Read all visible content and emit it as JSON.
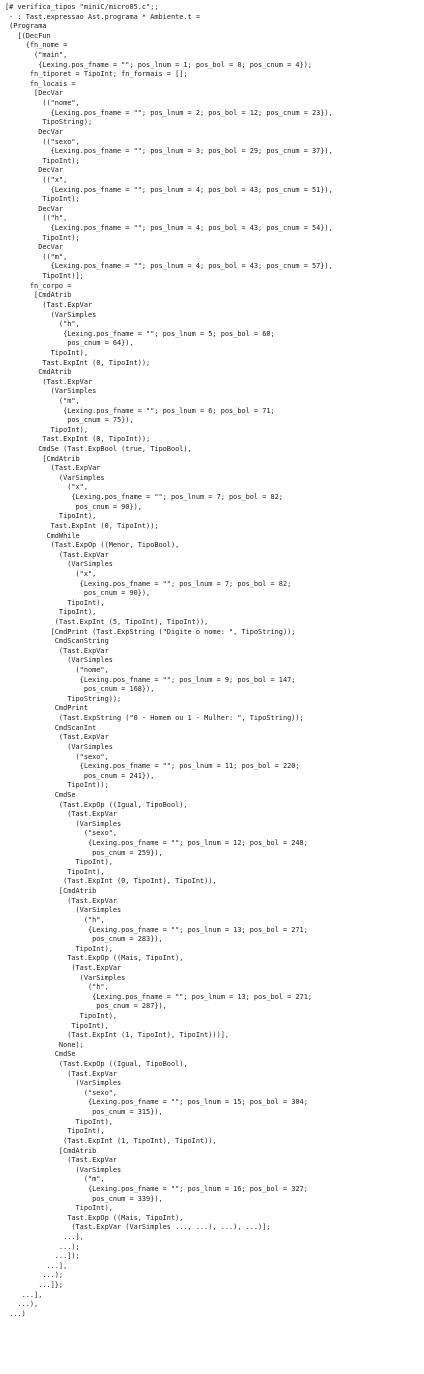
{
  "terminal": {
    "lines": [
      "[# verifica_tipos \"miniC/micro05.c\";;",
      " - : Tast.expressao Ast.programa * Ambiente.t =",
      " (Programa",
      "   [(DecFun",
      "     {fn_nome =",
      "       (\"main\",",
      "        {Lexing.pos_fname = \"\"; pos_lnum = 1; pos_bol = 0; pos_cnum = 4});",
      "      fn_tiporet = TipoInt; fn_formais = [];",
      "      fn_locais =",
      "       [DecVar",
      "         ((\"nome\",",
      "           {Lexing.pos_fname = \"\"; pos_lnum = 2; pos_bol = 12; pos_cnum = 23}),",
      "         TipoString);",
      "        DecVar",
      "         ((\"sexo\",",
      "           {Lexing.pos_fname = \"\"; pos_lnum = 3; pos_bol = 29; pos_cnum = 37}),",
      "         TipoInt);",
      "        DecVar",
      "         ((\"x\",",
      "           {Lexing.pos_fname = \"\"; pos_lnum = 4; pos_bol = 43; pos_cnum = 51}),",
      "         TipoInt);",
      "        DecVar",
      "         ((\"h\",",
      "           {Lexing.pos_fname = \"\"; pos_lnum = 4; pos_bol = 43; pos_cnum = 54}),",
      "         TipoInt);",
      "        DecVar",
      "         ((\"m\",",
      "           {Lexing.pos_fname = \"\"; pos_lnum = 4; pos_bol = 43; pos_cnum = 57}),",
      "         TipoInt)];",
      "      fn_corpo =",
      "       [CmdAtrib",
      "         (Tast.ExpVar",
      "           (VarSimples",
      "             (\"h\",",
      "              {Lexing.pos_fname = \"\"; pos_lnum = 5; pos_bol = 60;",
      "               pos_cnum = 64}),",
      "           TipoInt),",
      "         Tast.ExpInt (0, TipoInt));",
      "        CmdAtrib",
      "         (Tast.ExpVar",
      "           (VarSimples",
      "             (\"m\",",
      "              {Lexing.pos_fname = \"\"; pos_lnum = 6; pos_bol = 71;",
      "               pos_cnum = 75}),",
      "           TipoInt),",
      "         Tast.ExpInt (0, TipoInt));",
      "        CmdSe (Tast.ExpBool (true, TipoBool),",
      "         [CmdAtrib",
      "           (Tast.ExpVar",
      "             (VarSimples",
      "               (\"x\",",
      "                {Lexing.pos_fname = \"\"; pos_lnum = 7; pos_bol = 82;",
      "                 pos_cnum = 90}),",
      "             TipoInt),",
      "           Tast.ExpInt (0, TipoInt));",
      "          CmdWhile",
      "           (Tast.ExpOp ((Menor, TipoBool),",
      "             (Tast.ExpVar",
      "               (VarSimples",
      "                 (\"x\",",
      "                  {Lexing.pos_fname = \"\"; pos_lnum = 7; pos_bol = 82;",
      "                   pos_cnum = 90}),",
      "               TipoInt),",
      "             TipoInt),",
      "            (Tast.ExpInt (5, TipoInt), TipoInt)),",
      "           [CmdPrint (Tast.ExpString (\"Digite o nome: \", TipoString));",
      "            CmdScanString",
      "             (Tast.ExpVar",
      "               (VarSimples",
      "                 (\"nome\",",
      "                  {Lexing.pos_fname = \"\"; pos_lnum = 9; pos_bol = 147;",
      "                   pos_cnum = 168}),",
      "               TipoString));",
      "            CmdPrint",
      "             (Tast.ExpString (\"0 - Homem ou 1 - Mulher: \", TipoString));",
      "            CmdScanInt",
      "             (Tast.ExpVar",
      "               (VarSimples",
      "                 (\"sexo\",",
      "                  {Lexing.pos_fname = \"\"; pos_lnum = 11; pos_bol = 220;",
      "                   pos_cnum = 241}),",
      "               TipoInt));",
      "            CmdSe",
      "             (Tast.ExpOp ((Igual, TipoBool),",
      "               (Tast.ExpVar",
      "                 (VarSimples",
      "                   (\"sexo\",",
      "                    {Lexing.pos_fname = \"\"; pos_lnum = 12; pos_bol = 248;",
      "                     pos_cnum = 259}),",
      "                 TipoInt),",
      "               TipoInt),",
      "              (Tast.ExpInt (0, TipoInt), TipoInt)),",
      "             [CmdAtrib",
      "               (Tast.ExpVar",
      "                 (VarSimples",
      "                   (\"h\",",
      "                    {Lexing.pos_fname = \"\"; pos_lnum = 13; pos_bol = 271;",
      "                     pos_cnum = 283}),",
      "                 TipoInt),",
      "               Tast.ExpOp ((Mais, TipoInt),",
      "                (Tast.ExpVar",
      "                  (VarSimples",
      "                    (\"h\",",
      "                     {Lexing.pos_fname = \"\"; pos_lnum = 13; pos_bol = 271;",
      "                      pos_cnum = 287}),",
      "                  TipoInt),",
      "                TipoInt),",
      "               (Tast.ExpInt (1, TipoInt), TipoInt)))],",
      "             None);",
      "            CmdSe",
      "             (Tast.ExpOp ((Igual, TipoBool),",
      "               (Tast.ExpVar",
      "                 (VarSimples",
      "                   (\"sexo\",",
      "                    {Lexing.pos_fname = \"\"; pos_lnum = 15; pos_bol = 304;",
      "                     pos_cnum = 315}),",
      "                 TipoInt),",
      "               TipoInt),",
      "              (Tast.ExpInt (1, TipoInt), TipoInt)),",
      "             [CmdAtrib",
      "               (Tast.ExpVar",
      "                 (VarSimples",
      "                   (\"m\",",
      "                    {Lexing.pos_fname = \"\"; pos_lnum = 16; pos_bol = 327;",
      "                     pos_cnum = 339}),",
      "                 TipoInt),",
      "               Tast.ExpOp ((Mais, TipoInt),",
      "                (Tast.ExpVar (VarSimples ..., ...), ...), ...)];",
      "              ...],",
      "             ...);",
      "            ...]);",
      "          ...],",
      "         ...);",
      "        ...]};",
      "    ...],",
      "   ...),",
      " ...)"
    ]
  }
}
